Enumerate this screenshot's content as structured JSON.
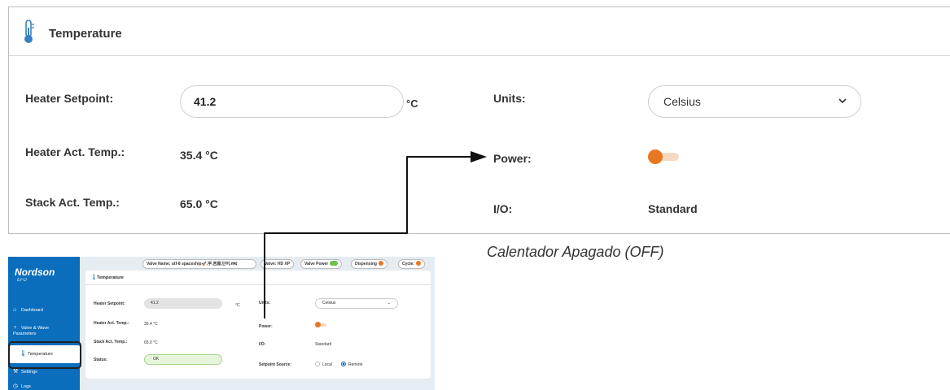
{
  "zoom": {
    "title": "Temperature",
    "heater_setpoint_label": "Heater Setpoint:",
    "heater_setpoint_value": "41.2",
    "setpoint_unit": "°C",
    "units_label": "Units:",
    "units_value": "Celsius",
    "heater_act_label": "Heater Act. Temp.:",
    "heater_act_value": "35.4 °C",
    "power_label": "Power:",
    "power_on": false,
    "stack_act_label": "Stack Act. Temp.:",
    "stack_act_value": "65.0 °C",
    "io_label": "I/O:",
    "io_value": "Standard"
  },
  "caption": "Calentador Apagado (OFF)",
  "mini": {
    "brand": "Nordson",
    "brand_sub": "EFD",
    "nav": [
      {
        "label": "Dashboard",
        "icon": "home-icon"
      },
      {
        "label": "Valve & Wave Parameters",
        "icon": "valve-icon"
      },
      {
        "label": "Temperature",
        "icon": "thermometer-icon"
      },
      {
        "label": "Settings",
        "icon": "wrench-icon"
      },
      {
        "label": "Logs",
        "icon": "clock-icon"
      }
    ],
    "top": {
      "valve_name": "Valve Name: utf-8 spaceship🚀,字,吉屋,단어,शब्द",
      "valve": "Valve: HD XP",
      "valve_power": "Valve Power",
      "dispensing": "Dispensing",
      "cycle": "Cycle:"
    },
    "card": {
      "title": "Temperature",
      "heater_setpoint_label": "Heater Setpoint:",
      "heater_setpoint_value": "41.2",
      "unit": "°C",
      "units_label": "Units:",
      "units_value": "Celsius",
      "heater_act_label": "Heater Act. Temp.:",
      "heater_act_value": "35.4 °C",
      "power_label": "Power:",
      "stack_act_label": "Stack Act. Temp.:",
      "stack_act_value": "65.0 °C",
      "io_label": "I/O:",
      "io_value": "Standard",
      "status_label": "Status:",
      "status_value": "OK",
      "setpoint_source_label": "Setpoint Source:",
      "setpoint_source_options": [
        "Local",
        "Remote"
      ],
      "setpoint_source_selected": "Remote"
    }
  },
  "colors": {
    "accent_orange": "#e87722",
    "brand_blue": "#0a6ebd",
    "status_green": "#a6d68a",
    "toggle_green": "#6cc24a"
  }
}
